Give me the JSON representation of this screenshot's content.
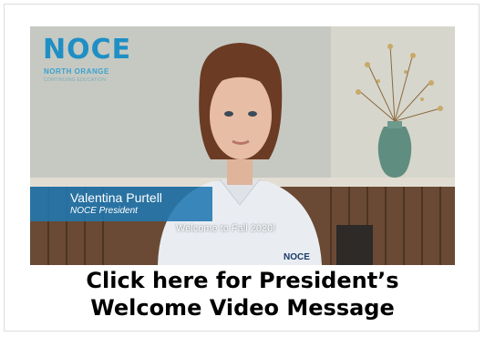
{
  "video": {
    "logo_text": "NOCE",
    "logo_subtitle": "NORTH ORANGE",
    "logo_subtitle2": "CONTINUING EDUCATION",
    "speaker_name": "Valentina Purtell",
    "speaker_title": "NOCE President",
    "caption": "Welcome to Fall 2020!",
    "shirt_text": "NOCE"
  },
  "link": {
    "line1": "Click here for President’s",
    "line2": "Welcome Video Message"
  }
}
